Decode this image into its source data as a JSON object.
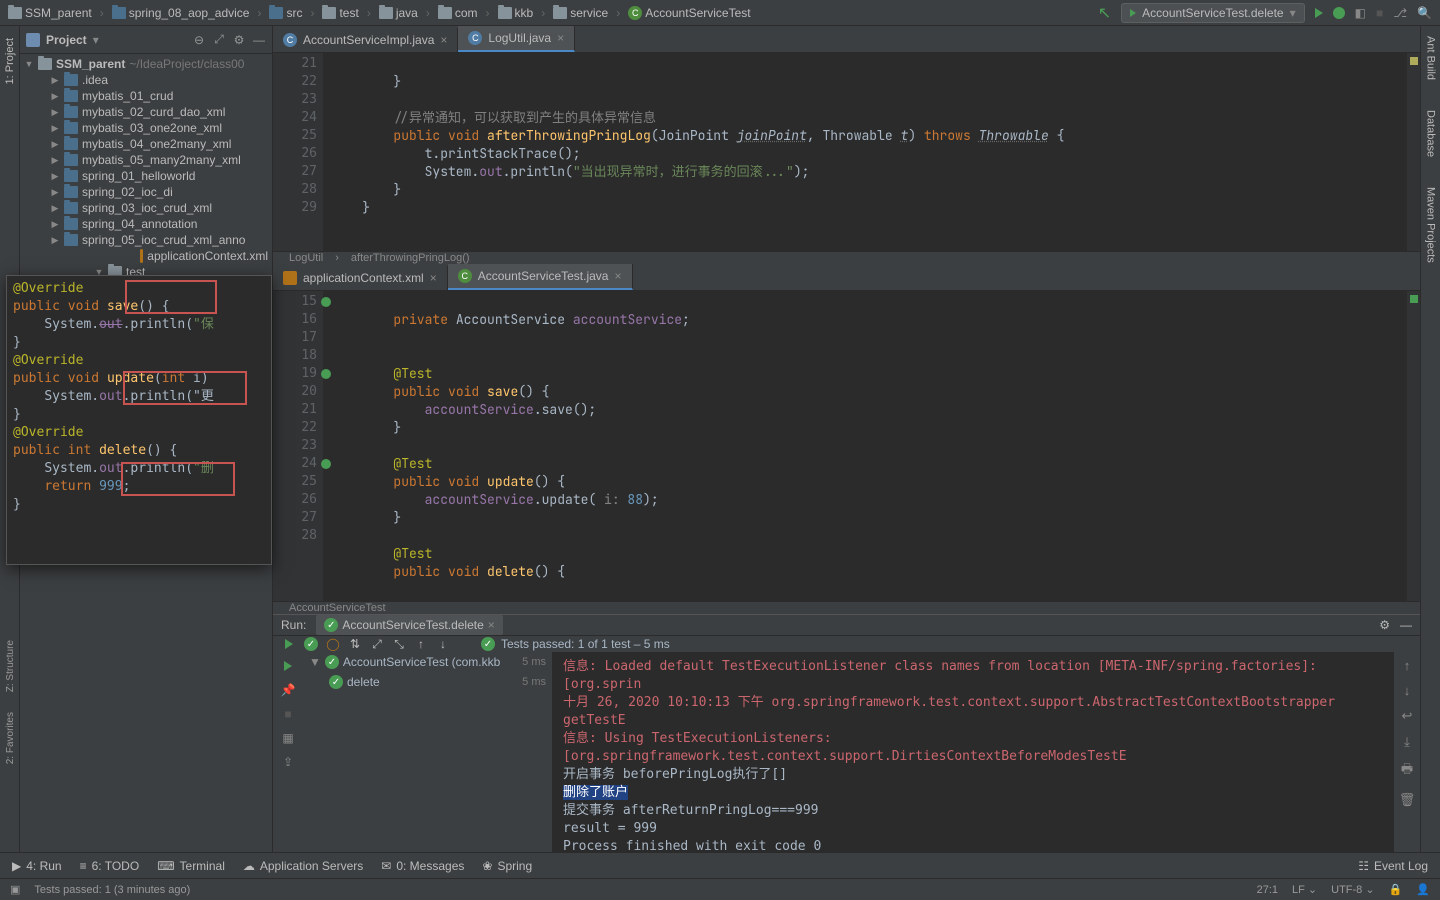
{
  "breadcrumb": [
    "SSM_parent",
    "spring_08_aop_advice",
    "src",
    "test",
    "java",
    "com",
    "kkb",
    "service",
    "AccountServiceTest"
  ],
  "run_config": {
    "label": "AccountServiceTest.delete"
  },
  "project": {
    "title": "Project",
    "root": "SSM_parent",
    "root_hint": "~/IdeaProject/class00",
    "items": [
      {
        "indent": 30,
        "arrow": "▶",
        "name": ".idea"
      },
      {
        "indent": 30,
        "arrow": "▶",
        "name": "mybatis_01_crud"
      },
      {
        "indent": 30,
        "arrow": "▶",
        "name": "mybatis_02_curd_dao_xml"
      },
      {
        "indent": 30,
        "arrow": "▶",
        "name": "mybatis_03_one2one_xml"
      },
      {
        "indent": 30,
        "arrow": "▶",
        "name": "mybatis_04_one2many_xml"
      },
      {
        "indent": 30,
        "arrow": "▶",
        "name": "mybatis_05_many2many_xml"
      },
      {
        "indent": 30,
        "arrow": "▶",
        "name": "spring_01_helloworld"
      },
      {
        "indent": 30,
        "arrow": "▶",
        "name": "spring_02_ioc_di"
      },
      {
        "indent": 30,
        "arrow": "▶",
        "name": "spring_03_ioc_crud_xml"
      },
      {
        "indent": 30,
        "arrow": "▶",
        "name": "spring_04_annotation"
      },
      {
        "indent": 30,
        "arrow": "▶",
        "name": "spring_05_ioc_crud_xml_anno"
      }
    ],
    "tail_items": [
      {
        "indent": 120,
        "kind": "xml",
        "name": "applicationContext.xml"
      },
      {
        "indent": 74,
        "arrow": "▼",
        "kind": "folder",
        "name": "test"
      }
    ]
  },
  "editor_top": {
    "tabs": [
      {
        "name": "AccountServiceImpl.java",
        "sel": false,
        "cls": "c"
      },
      {
        "name": "LogUtil.java",
        "sel": true,
        "cls": "c"
      }
    ],
    "gutter": [
      "21",
      "22",
      "23",
      "24",
      "25",
      "26",
      "27",
      "28",
      "29"
    ],
    "breadcrumb": [
      "LogUtil",
      "afterThrowingPringLog()"
    ]
  },
  "editor_bottom": {
    "tabs": [
      {
        "name": "applicationContext.xml",
        "sel": false,
        "kind": "xml"
      },
      {
        "name": "AccountServiceTest.java",
        "sel": true,
        "kind": "c"
      }
    ],
    "gutter": [
      "15",
      "16",
      "17",
      "18",
      "19",
      "20",
      "21",
      "22",
      "23",
      "24",
      "25",
      "26",
      "27",
      "28",
      ""
    ],
    "breadcrumb": [
      "AccountServiceTest"
    ]
  },
  "code_top": {
    "comment": "//异常通知，可以获取到产生的具体异常信息",
    "sig_kw1": "public",
    "sig_kw2": "void",
    "sig_method": "afterThrowingPringLog",
    "param1_type": "JoinPoint",
    "param1_name": "joinPoint",
    "param2_type": "Throwable",
    "param2_name": "t",
    "throws_kw": "throws",
    "throws_type": "Throwable",
    "line1": "t.printStackTrace();",
    "println_head": "System.",
    "println_out": "out",
    "println_call": ".println(",
    "println_str": "\"当出现异常时，进行事务的回滚...\"",
    "println_end": ");"
  },
  "code_bottom": {
    "priv": "private",
    "svc_type": "AccountService",
    "svc_name": "accountService",
    "ann": "@Test",
    "pub": "public",
    "void": "void",
    "m_save": "save",
    "m_update": "update",
    "m_delete": "delete",
    "save_body": "accountService",
    "save_call": ".save();",
    "update_body": "accountService",
    "update_call": ".update(",
    "update_hint": " i: ",
    "update_num": "88",
    "update_end": ");"
  },
  "popup": {
    "ov": "@Override",
    "pub": "public",
    "void": "void",
    "int": "int",
    "save": "save",
    "update": "update",
    "delete": "delete",
    "int_param": "int",
    "param_i": "i",
    "sys": "System.",
    "out": "out",
    "println": ".println(",
    "q": "\"保",
    "update_body": ".println(\"更",
    "ret": "return",
    "ret_val": "999",
    "semi": ";"
  },
  "run": {
    "title": "Run:",
    "tab": "AccountServiceTest.delete",
    "tests_passed_prefix": "Tests passed:",
    "tests_passed_detail": "1 of 1 test – 5 ms",
    "tree_root": "AccountServiceTest (com.kkb",
    "tree_root_ms": "5 ms",
    "tree_child": "delete",
    "tree_child_ms": "5 ms",
    "console": [
      {
        "cls": "red",
        "t": "信息: Loaded default TestExecutionListener class names from location [META-INF/spring.factories]: [org.sprin"
      },
      {
        "cls": "red",
        "t": "十月 26, 2020 10:10:13 下午 org.springframework.test.context.support.AbstractTestContextBootstrapper getTestE"
      },
      {
        "cls": "red",
        "t": "信息: Using TestExecutionListeners: [org.springframework.test.context.support.DirtiesContextBeforeModesTestE"
      },
      {
        "cls": "",
        "t": "开启事务 beforePringLog执行了[]"
      },
      {
        "cls": "sel",
        "t": "删除了账户"
      },
      {
        "cls": "",
        "t": "提交事务 afterReturnPringLog===999"
      },
      {
        "cls": "",
        "t": "result = 999"
      },
      {
        "cls": "",
        "t": ""
      },
      {
        "cls": "",
        "t": "Process finished with exit code 0"
      }
    ]
  },
  "toolbar": {
    "run": "4: Run",
    "todo": "6: TODO",
    "terminal": "Terminal",
    "app_servers": "Application Servers",
    "messages": "0: Messages",
    "spring": "Spring",
    "event_log": "Event Log"
  },
  "status": {
    "msg": "Tests passed: 1 (3 minutes ago)",
    "pos": "27:1",
    "lf": "LF",
    "enc": "UTF-8"
  },
  "right_rail": [
    "Ant Build",
    "Database",
    "Maven Projects"
  ],
  "left_rail": [
    "1: Project"
  ],
  "left_stripe": [
    "Z: Structure",
    "2: Favorites"
  ]
}
